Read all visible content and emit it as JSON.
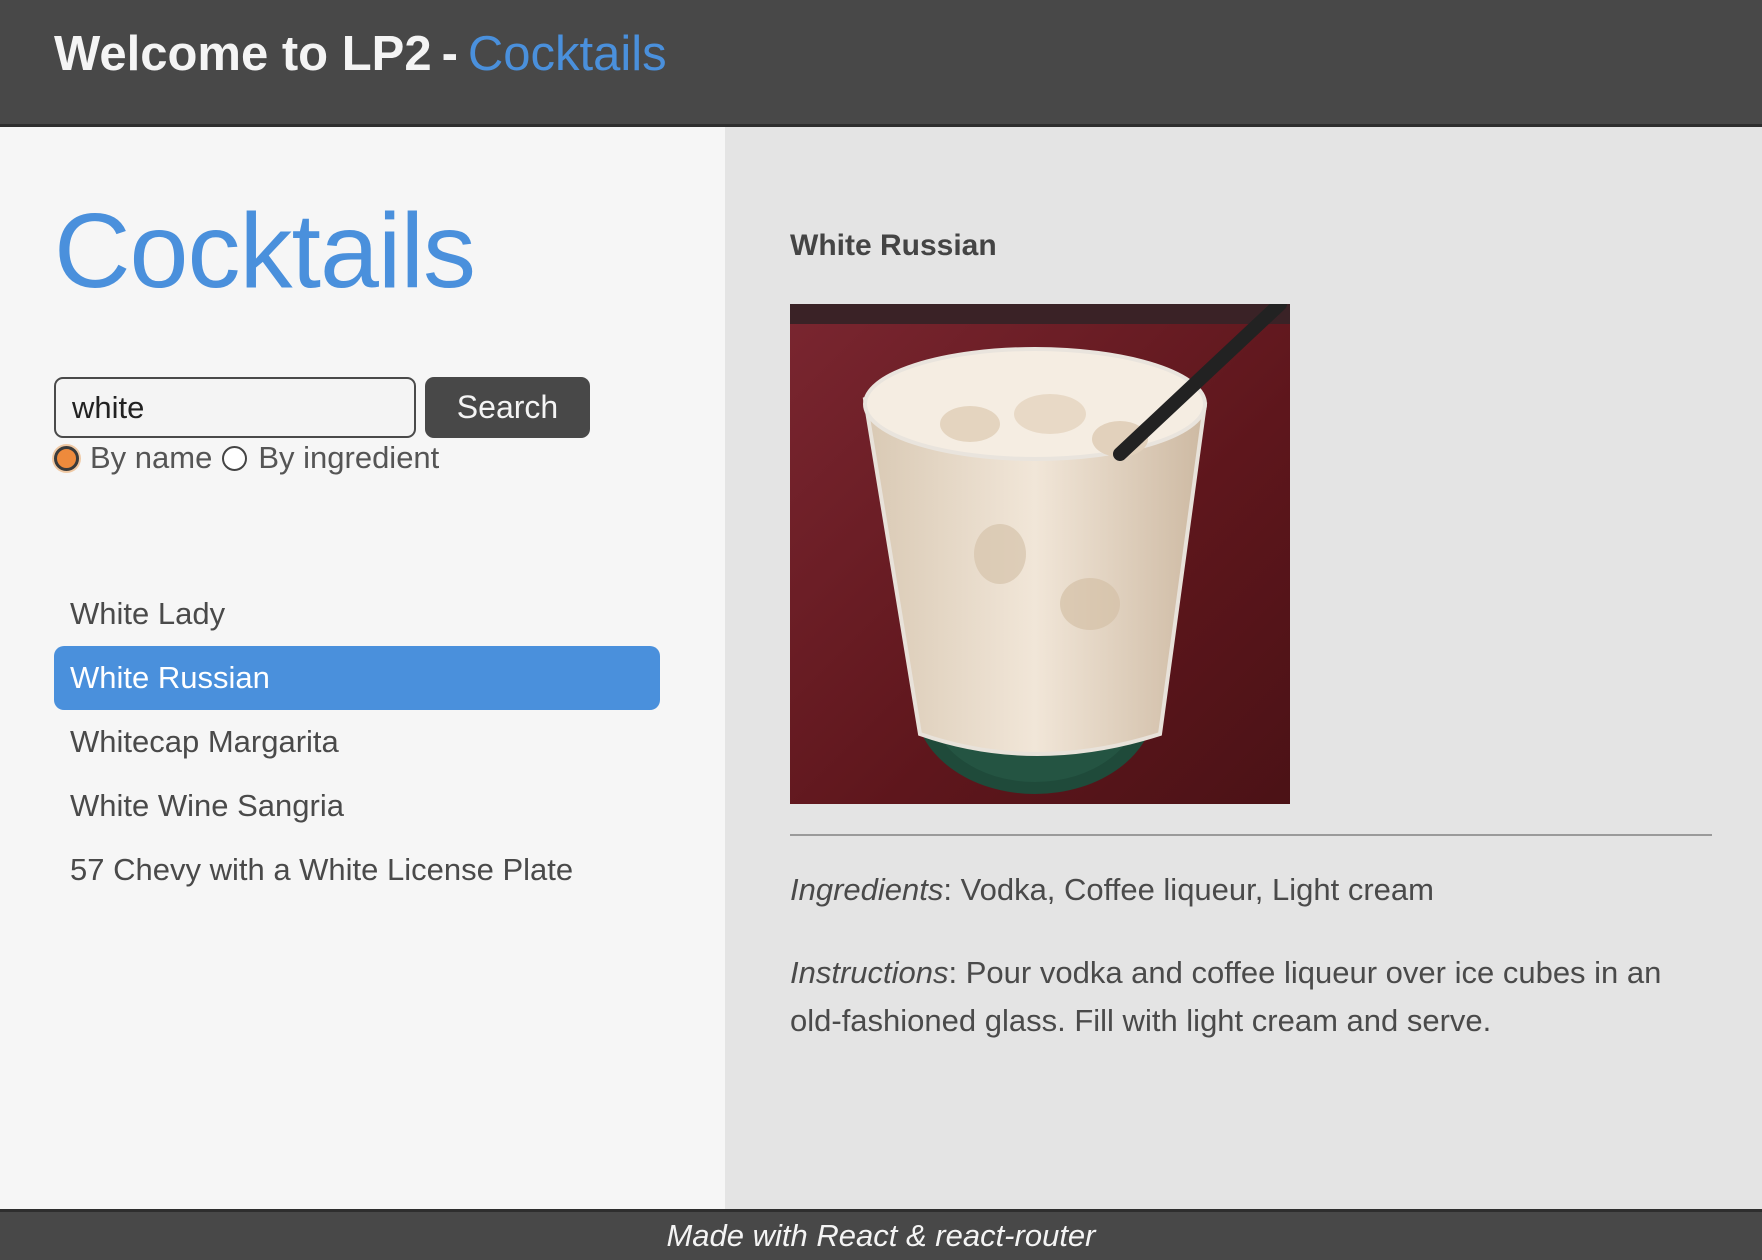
{
  "header": {
    "title": "Welcome to LP2",
    "separator": "-",
    "section": "Cocktails"
  },
  "left": {
    "heading": "Cocktails",
    "search": {
      "value": "white",
      "button_label": "Search"
    },
    "filter": {
      "options": [
        {
          "label": "By name",
          "checked": true
        },
        {
          "label": "By ingredient",
          "checked": false
        }
      ]
    },
    "results": [
      {
        "label": "White Lady",
        "selected": false
      },
      {
        "label": "White Russian",
        "selected": true
      },
      {
        "label": "Whitecap Margarita",
        "selected": false
      },
      {
        "label": "White Wine Sangria",
        "selected": false
      },
      {
        "label": "57 Chevy with a White License Plate",
        "selected": false
      }
    ]
  },
  "detail": {
    "title": "White Russian",
    "image_icon": "cocktail-photo",
    "ingredients_label": "Ingredients",
    "ingredients_value": ": Vodka, Coffee liqueur, Light cream",
    "instructions_label": "Instructions",
    "instructions_value": ": Pour vodka and coffee liqueur over ice cubes in an old-fashioned glass. Fill with light cream and serve."
  },
  "footer": {
    "text": "Made with React & react-router"
  },
  "colors": {
    "accent": "#4a90dc",
    "header_bg": "#484848",
    "radio_checked": "#ee8a3c"
  }
}
